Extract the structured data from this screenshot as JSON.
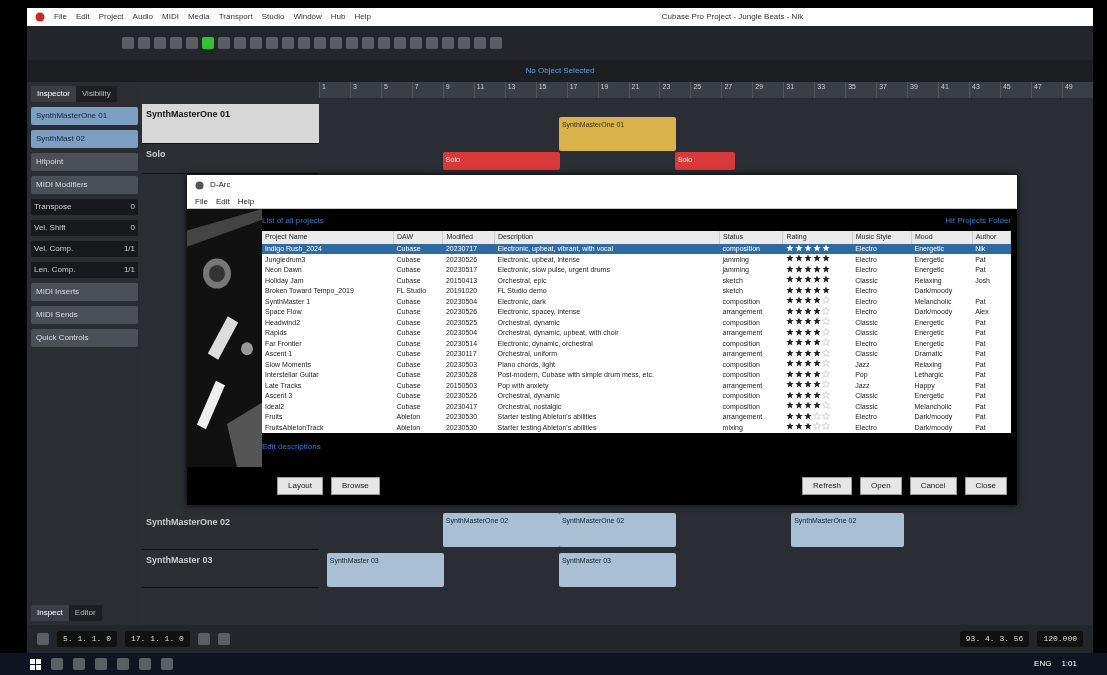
{
  "window": {
    "title": "Cubase Pro Project - Jungle Beats - Nik"
  },
  "menu": [
    "File",
    "Edit",
    "Project",
    "Audio",
    "MIDI",
    "Media",
    "Transport",
    "Studio",
    "Window",
    "Hub",
    "Help"
  ],
  "info_line": "No Object Selected",
  "inspector": {
    "tabs": [
      {
        "label": "Inspector",
        "selected": true
      },
      {
        "label": "Visibility",
        "selected": false
      }
    ],
    "sections": [
      {
        "label": "SynthMasterOne 01",
        "expanded": true
      },
      {
        "label": "SynthMast 02",
        "expanded": true
      },
      {
        "label": "Hitpoint",
        "expanded": false
      },
      {
        "label": "MIDI Modifiers",
        "expanded": false
      }
    ],
    "params": [
      {
        "label": "Transpose",
        "value": "0"
      },
      {
        "label": "Vel. Shift",
        "value": "0"
      },
      {
        "label": "Vel. Comp.",
        "value": "1/1"
      },
      {
        "label": "Len. Comp.",
        "value": "1/1"
      }
    ],
    "footer": [
      {
        "label": "MIDI Inserts"
      },
      {
        "label": "MIDI Sends"
      },
      {
        "label": "Quick Controls"
      }
    ],
    "bottom_tabs": [
      {
        "label": "Inspect",
        "selected": true
      },
      {
        "label": "Editor",
        "selected": false
      }
    ]
  },
  "tracks": [
    {
      "name": "SynthMasterOne 01",
      "selected": true
    },
    {
      "name": "Solo",
      "selected": false
    },
    {
      "name": "SynthMasterOne 02",
      "selected": false
    },
    {
      "name": "SynthMaster 03",
      "selected": false
    }
  ],
  "ruler": [
    "1",
    "3",
    "5",
    "7",
    "9",
    "11",
    "13",
    "15",
    "17",
    "19",
    "21",
    "23",
    "25",
    "27",
    "29",
    "31",
    "33",
    "35",
    "37",
    "39",
    "41",
    "43",
    "45",
    "47",
    "49"
  ],
  "regions": [
    {
      "label": "SynthMasterOne 01",
      "kind": "midi"
    },
    {
      "label": "Solo",
      "kind": "folder"
    },
    {
      "label": "Solo",
      "kind": "folder"
    },
    {
      "label": "SynthMasterOne 02",
      "kind": "part"
    },
    {
      "label": "SynthMasterOne 02",
      "kind": "part"
    },
    {
      "label": "SynthMasterOne 02",
      "kind": "part"
    },
    {
      "label": "SynthMaster 03",
      "kind": "part"
    },
    {
      "label": "SynthMaster 03",
      "kind": "part"
    }
  ],
  "dialog": {
    "title": "D-Arc",
    "menu": [
      "File",
      "Edit",
      "Help"
    ],
    "link": "List of all projects",
    "link_right": "Hit Projects Folder",
    "columns": [
      "Project Name",
      "DAW",
      "Modified",
      "Description",
      "Status",
      "Rating",
      "Music Style",
      "Mood",
      "Author"
    ],
    "rows": [
      {
        "name": "Indigo Rush_2024",
        "daw": "Cubase",
        "modified": "20230717",
        "description": "Electronic, upbeat, vibrant, with vocal",
        "status": "composition",
        "stars": 5,
        "style": "Electro",
        "mood": "Energetic",
        "author": "Nik",
        "selected": true
      },
      {
        "name": "Jungledrum3",
        "daw": "Cubase",
        "modified": "20230526",
        "description": "Electronic, upbeat, intense",
        "status": "jamming",
        "stars": 5,
        "style": "Electro",
        "mood": "Energetic",
        "author": "Pat",
        "selected": false
      },
      {
        "name": "Neon Dawn",
        "daw": "Cubase",
        "modified": "20230517",
        "description": "Electronic, slow pulse, urgent drums",
        "status": "jamming",
        "stars": 5,
        "style": "Electro",
        "mood": "Energetic",
        "author": "Pat",
        "selected": false
      },
      {
        "name": "Holiday Jam",
        "daw": "Cubase",
        "modified": "20150413",
        "description": "Orchestral, epic",
        "status": "sketch",
        "stars": 5,
        "style": "Classic",
        "mood": "Relaxing",
        "author": "Josh",
        "selected": false
      },
      {
        "name": "Broken Toward Tempo_2019",
        "daw": "FL Studio",
        "modified": "20191020",
        "description": "FL Studio demo",
        "status": "sketch",
        "stars": 5,
        "style": "Electro",
        "mood": "Dark/moody",
        "selected": false
      },
      {
        "name": "SynthMaster 1",
        "daw": "Cubase",
        "modified": "20230504",
        "description": "Electronic, dark",
        "status": "composition",
        "stars": 4,
        "style": "Electro",
        "mood": "Melancholic",
        "author": "Pat",
        "selected": false
      },
      {
        "name": "Space Flow",
        "daw": "Cubase",
        "modified": "20230526",
        "description": "Electronic, spacey, intense",
        "status": "arrangement",
        "stars": 4,
        "style": "Electro",
        "mood": "Dark/moody",
        "author": "Alex",
        "selected": false
      },
      {
        "name": "Headwind2",
        "daw": "Cubase",
        "modified": "20230525",
        "description": "Orchestral, dynamic",
        "status": "composition",
        "stars": 4,
        "style": "Classic",
        "mood": "Energetic",
        "author": "Pat",
        "selected": false
      },
      {
        "name": "Rapids",
        "daw": "Cubase",
        "modified": "20230504",
        "description": "Orchestral, dynamic, upbeat, with choir",
        "status": "arrangement",
        "stars": 4,
        "style": "Classic",
        "mood": "Energetic",
        "author": "Pat",
        "selected": false
      },
      {
        "name": "Far Frontier",
        "daw": "Cubase",
        "modified": "20230514",
        "description": "Electronic, dynamic, orchestral",
        "status": "composition",
        "stars": 4,
        "style": "Electro",
        "mood": "Energetic",
        "author": "Pat",
        "selected": false
      },
      {
        "name": "Ascent 1",
        "daw": "Cubase",
        "modified": "20230117",
        "description": "Orchestral, uniform",
        "status": "arrangement",
        "stars": 4,
        "style": "Classic",
        "mood": "Dramatic",
        "author": "Pat",
        "selected": false
      },
      {
        "name": "Slow Moments",
        "daw": "Cubase",
        "modified": "20230503",
        "description": "Piano chords, light",
        "status": "composition",
        "stars": 4,
        "style": "Jazz",
        "mood": "Relaxing",
        "author": "Pat",
        "selected": false
      },
      {
        "name": "Interstellar Guitar",
        "daw": "Cubase",
        "modified": "20230528",
        "description": "Post-modern, Cubase with simple drum mess, etc.",
        "status": "composition",
        "stars": 4,
        "style": "Pop",
        "mood": "Lethargic",
        "author": "Pat",
        "selected": false
      },
      {
        "name": "Late Tracks",
        "daw": "Cubase",
        "modified": "20150503",
        "description": "Pop with anxiety",
        "status": "arrangement",
        "stars": 4,
        "style": "Jazz",
        "mood": "Happy",
        "author": "Pat",
        "selected": false
      },
      {
        "name": "Ascent 3",
        "daw": "Cubase",
        "modified": "20230526",
        "description": "Orchestral, dynamic",
        "status": "composition",
        "stars": 4,
        "style": "Classic",
        "mood": "Energetic",
        "author": "Pat",
        "selected": false
      },
      {
        "name": "Ideal2",
        "daw": "Cubase",
        "modified": "20230417",
        "description": "Orchestral, nostalgic",
        "status": "composition",
        "stars": 4,
        "style": "Classic",
        "mood": "Melancholic",
        "author": "Pat",
        "selected": false
      },
      {
        "name": "Fruits",
        "daw": "Ableton",
        "modified": "20230530",
        "description": "Starter testing Ableton's abilities",
        "status": "arrangement",
        "stars": 3,
        "style": "Electro",
        "mood": "Dark/moody",
        "author": "Pat",
        "selected": false
      },
      {
        "name": "FruitsAbletonTrack",
        "daw": "Ableton",
        "modified": "20230530",
        "description": "Starter testing Ableton's abilities",
        "status": "mixing",
        "stars": 3,
        "style": "Electro",
        "mood": "Dark/moody",
        "author": "Pat",
        "selected": false
      }
    ],
    "edit_link": "Edit descriptions",
    "buttons_left": [
      "Layout",
      "Browse"
    ],
    "buttons_right": [
      "Refresh",
      "Open",
      "Cancel",
      "Close"
    ]
  },
  "transport": {
    "position_left": "5. 1. 1.   0",
    "position_right": "17. 1. 1.   0",
    "position_main": "93. 4. 3. 56",
    "tempo": "120.000"
  },
  "taskbar": {
    "language": "ENG",
    "time": "1:01"
  }
}
